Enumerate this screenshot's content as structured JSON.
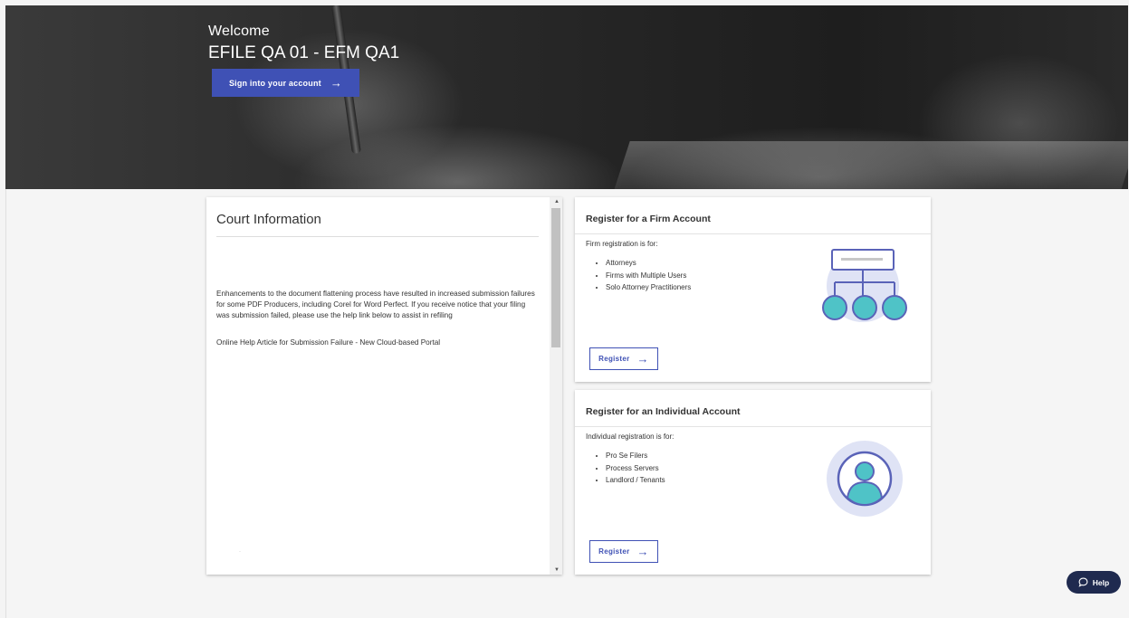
{
  "hero": {
    "welcome": "Welcome",
    "court_name": "EFILE QA 01 - EFM QA1",
    "signin_label": "Sign into your account",
    "arrow": "→"
  },
  "court_info": {
    "title": "Court Information",
    "body": "Enhancements to the document flattening process have resulted in increased submission failures for some PDF Producers, including Corel for Word Perfect. If you receive notice that your filing was submission failed, please use the help link below to assist in refiling",
    "help_link": "Online Help Article for Submission Failure - New Cloud-based Portal",
    "dot": "·"
  },
  "firm": {
    "title": "Register for a Firm Account",
    "intro": "Firm registration is for:",
    "items": [
      "Attorneys",
      "Firms with Multiple Users",
      "Solo Attorney Practitioners"
    ],
    "register_label": "Register"
  },
  "individual": {
    "title": "Register for an Individual Account",
    "intro": "Individual registration is for:",
    "items": [
      "Pro Se Filers",
      "Process Servers",
      "Landlord / Tenants"
    ],
    "register_label": "Register"
  },
  "help": {
    "label": "Help"
  },
  "colors": {
    "primary": "#3f51b5",
    "teal": "#4fc3c7",
    "help_bg": "#1f2a4f"
  }
}
